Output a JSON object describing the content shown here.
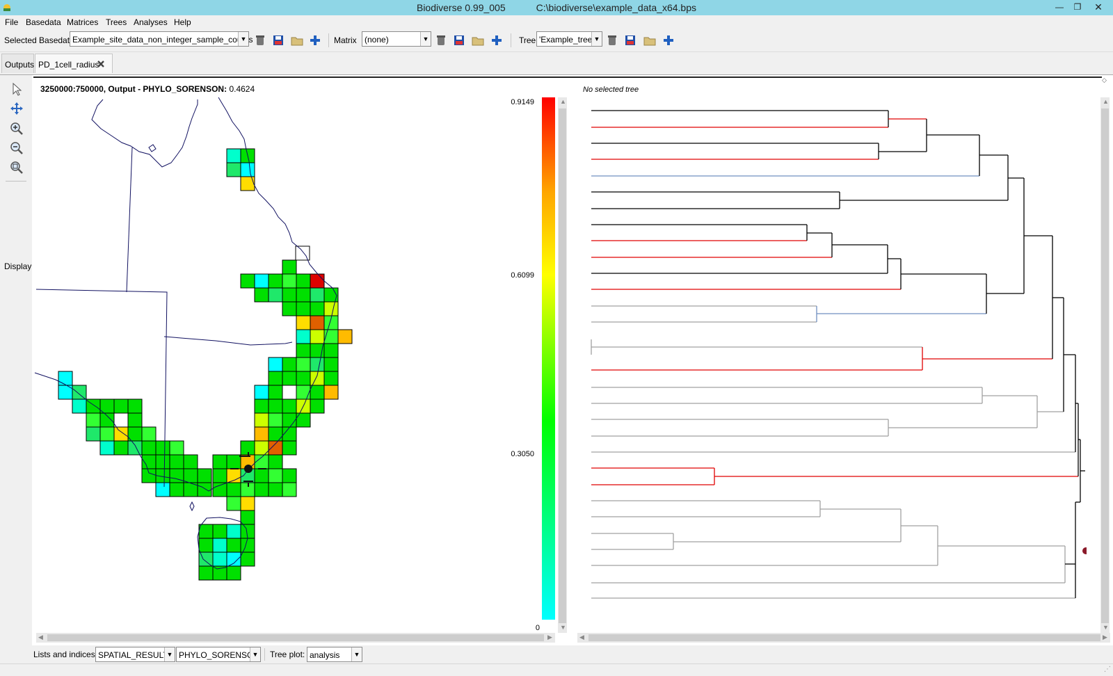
{
  "window": {
    "title_app": "Biodiverse 0.99_005",
    "title_path": "C:\\biodiverse\\example_data_x64.bps"
  },
  "menu": [
    {
      "label": "File"
    },
    {
      "label": "Basedata"
    },
    {
      "label": "Matrices"
    },
    {
      "label": "Trees"
    },
    {
      "label": "Analyses"
    },
    {
      "label": "Help"
    }
  ],
  "toolbar": {
    "basedata_label": "Selected Basedata",
    "basedata_value": "Example_site_data_non_integer_sample_counts",
    "matrix_label": "Matrix",
    "matrix_value": "(none)",
    "tree_label": "Tree",
    "tree_value": "'Example_tree'"
  },
  "tabs": [
    {
      "label": "Outputs",
      "active": false
    },
    {
      "label": "PD_1cell_radius",
      "active": true
    }
  ],
  "left_tools": {
    "display_label": "Display",
    "icons": [
      "select-arrow-icon",
      "pan-icon",
      "zoom-in-icon",
      "zoom-out-icon",
      "zoom-fit-icon"
    ]
  },
  "map": {
    "header_coords": "3250000:750000, Output - PHYLO_SORENSON:",
    "header_value": "0.4624"
  },
  "scale": {
    "max": "0.9149",
    "mid_high": "0.6099",
    "mid_low": "0.3050",
    "min": "0"
  },
  "tree_panel": {
    "header": "No selected tree"
  },
  "bottom": {
    "lists_label": "Lists and indices:",
    "list_value": "SPATIAL_RESULTS",
    "index_value": "PHYLO_SORENSON",
    "tree_plot_label": "Tree plot:",
    "tree_plot_value": "analysis"
  },
  "colors": {
    "titlebar": "#8fd6e6",
    "tree_red": "#e00000",
    "tree_blue_line": "#0000c8",
    "tree_grey": "#a0a0a0",
    "tree_blue_branch": "#6f8fc0"
  }
}
